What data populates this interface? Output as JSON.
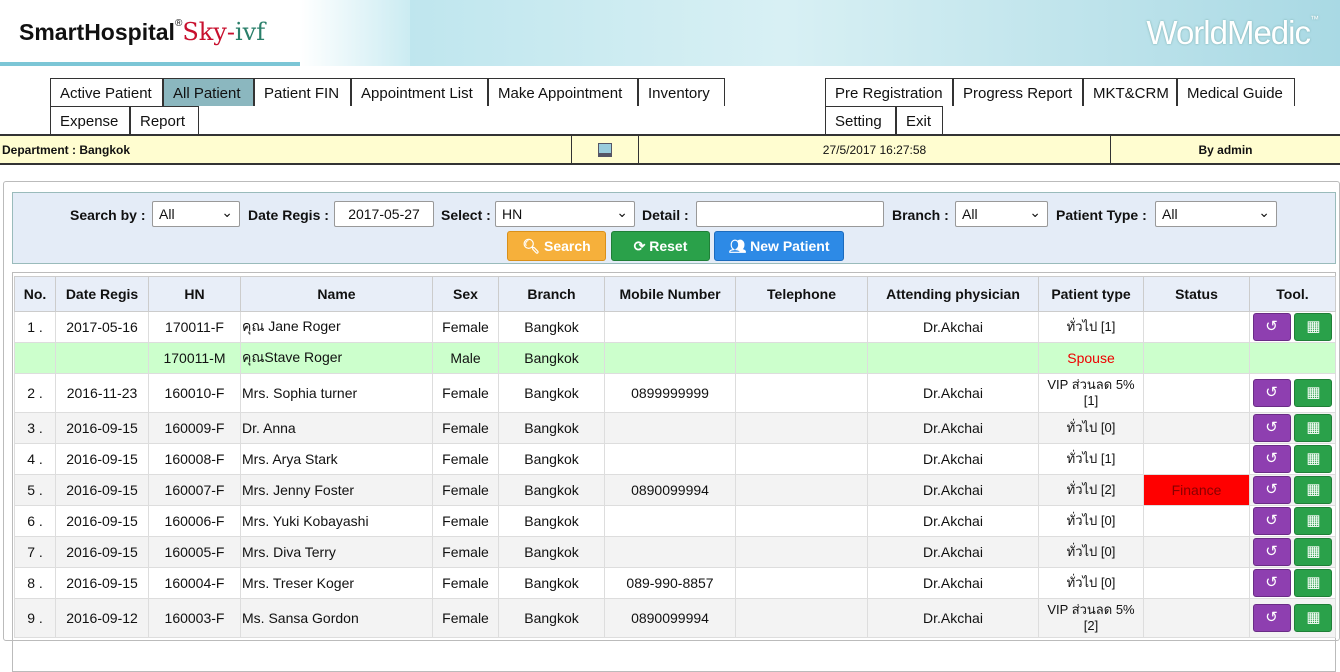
{
  "header": {
    "brand": "SmartHospital",
    "reg": "®",
    "sky": "Sky-",
    "ivf": "ivf",
    "world": "WorldMedic",
    "tm": "™"
  },
  "tabs": {
    "active_patient": "Active Patient",
    "all_patient": "All Patient",
    "patient_fin": "Patient FIN",
    "appointment_list": "Appointment List",
    "make_appointment": "Make Appointment",
    "inventory": "Inventory",
    "expense": "Expense",
    "report": "Report",
    "pre_registration": "Pre Registration",
    "progress_report": "Progress Report",
    "mkt_crm": "MKT&CRM",
    "medical_guide": "Medical Guide",
    "setting": "Setting",
    "exit": "Exit"
  },
  "info": {
    "department": "Department : Bangkok",
    "datetime": "27/5/2017 16:27:58",
    "user": "By admin"
  },
  "search": {
    "search_by_label": "Search by :",
    "search_by_value": "All",
    "date_regis_label": "Date Regis :",
    "date_regis_value": "2017-05-27",
    "select_label": "Select :",
    "select_value": "HN",
    "detail_label": "Detail :",
    "detail_value": "",
    "branch_label": "Branch :",
    "branch_value": "All",
    "patient_type_label": "Patient Type :",
    "patient_type_value": "All",
    "search_btn": "Search",
    "reset_btn": "Reset",
    "new_btn": "New Patient"
  },
  "columns": {
    "no": "No.",
    "date": "Date Regis",
    "hn": "HN",
    "name": "Name",
    "sex": "Sex",
    "branch": "Branch",
    "mobile": "Mobile Number",
    "tel": "Telephone",
    "physician": "Attending physician",
    "ptype": "Patient type",
    "status": "Status",
    "tool": "Tool."
  },
  "rows": [
    {
      "no": "1 .",
      "date": "2017-05-16",
      "hn": "170011-F",
      "name": "คุณ Jane Roger",
      "sex": "Female",
      "branch": "Bangkok",
      "mobile": "",
      "tel": "",
      "physician": "Dr.Akchai",
      "ptype": "ทั่วไป [1]",
      "status": ""
    },
    {
      "no": "",
      "date": "",
      "hn": "170011-M",
      "name": "คุณStave Roger",
      "sex": "Male",
      "branch": "Bangkok",
      "mobile": "",
      "tel": "",
      "physician": "",
      "ptype": "Spouse",
      "status": ""
    },
    {
      "no": "2 .",
      "date": "2016-11-23",
      "hn": "160010-F",
      "name": "Mrs. Sophia turner",
      "sex": "Female",
      "branch": "Bangkok",
      "mobile": "0899999999",
      "tel": "",
      "physician": "Dr.Akchai",
      "ptype": "VIP ส่วนลด 5% [1]",
      "status": ""
    },
    {
      "no": "3 .",
      "date": "2016-09-15",
      "hn": "160009-F",
      "name": "Dr. Anna",
      "sex": "Female",
      "branch": "Bangkok",
      "mobile": "",
      "tel": "",
      "physician": "Dr.Akchai",
      "ptype": "ทั่วไป [0]",
      "status": ""
    },
    {
      "no": "4 .",
      "date": "2016-09-15",
      "hn": "160008-F",
      "name": "Mrs. Arya Stark",
      "sex": "Female",
      "branch": "Bangkok",
      "mobile": "",
      "tel": "",
      "physician": "Dr.Akchai",
      "ptype": "ทั่วไป [1]",
      "status": ""
    },
    {
      "no": "5 .",
      "date": "2016-09-15",
      "hn": "160007-F",
      "name": "Mrs. Jenny Foster",
      "sex": "Female",
      "branch": "Bangkok",
      "mobile": "0890099994",
      "tel": "",
      "physician": "Dr.Akchai",
      "ptype": "ทั่วไป [2]",
      "status": "Finance"
    },
    {
      "no": "6 .",
      "date": "2016-09-15",
      "hn": "160006-F",
      "name": "Mrs. Yuki Kobayashi",
      "sex": "Female",
      "branch": "Bangkok",
      "mobile": "",
      "tel": "",
      "physician": "Dr.Akchai",
      "ptype": "ทั่วไป [0]",
      "status": ""
    },
    {
      "no": "7 .",
      "date": "2016-09-15",
      "hn": "160005-F",
      "name": "Mrs. Diva Terry",
      "sex": "Female",
      "branch": "Bangkok",
      "mobile": "",
      "tel": "",
      "physician": "Dr.Akchai",
      "ptype": "ทั่วไป [0]",
      "status": ""
    },
    {
      "no": "8 .",
      "date": "2016-09-15",
      "hn": "160004-F",
      "name": "Mrs. Treser Koger",
      "sex": "Female",
      "branch": "Bangkok",
      "mobile": "089-990-8857",
      "tel": "",
      "physician": "Dr.Akchai",
      "ptype": "ทั่วไป [0]",
      "status": ""
    },
    {
      "no": "9 .",
      "date": "2016-09-12",
      "hn": "160003-F",
      "name": "Ms. Sansa Gordon",
      "sex": "Female",
      "branch": "Bangkok",
      "mobile": "0890099994",
      "tel": "",
      "physician": "Dr.Akchai",
      "ptype": "VIP ส่วนลด 5% [2]",
      "status": ""
    }
  ],
  "colors": {
    "active_tab": "#8bb7bf",
    "spouse_row": "#ccffcc",
    "finance": "#ff0000",
    "history_btn": "#8e3fb0",
    "calendar_btn": "#2aa14a"
  }
}
